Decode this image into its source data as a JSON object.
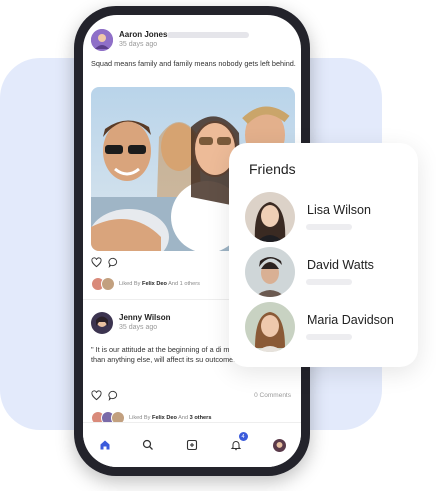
{
  "colors": {
    "accent": "#3b5bdb",
    "background_blob": "#e3eafb",
    "phone_frame": "#23232b"
  },
  "feed": {
    "posts": [
      {
        "author": "Aaron Jones",
        "time": "35 days ago",
        "text": "Squad means family and family means nobody gets left behind.",
        "liked_prefix": "Liked By",
        "liked_name": "Felix Deo",
        "liked_and": "And",
        "liked_others": "1 others"
      },
      {
        "author": "Jenny Wilson",
        "time": "35 days ago",
        "text": "\" It is our attitude at the beginning of a di more than anything else, will affect its su outcome.\"",
        "comments": "0 Comments",
        "liked_prefix": "Liked By",
        "liked_name": "Felix Deo",
        "liked_and": "And",
        "liked_others": "3 others"
      }
    ]
  },
  "bottom_nav": {
    "items": [
      {
        "icon": "home-icon",
        "active": true
      },
      {
        "icon": "search-icon"
      },
      {
        "icon": "add-post-icon"
      },
      {
        "icon": "bell-icon",
        "badge": "4"
      },
      {
        "icon": "profile-avatar"
      }
    ]
  },
  "friends": {
    "title": "Friends",
    "items": [
      {
        "name": "Lisa Wilson"
      },
      {
        "name": "David Watts"
      },
      {
        "name": "Maria Davidson"
      }
    ]
  }
}
